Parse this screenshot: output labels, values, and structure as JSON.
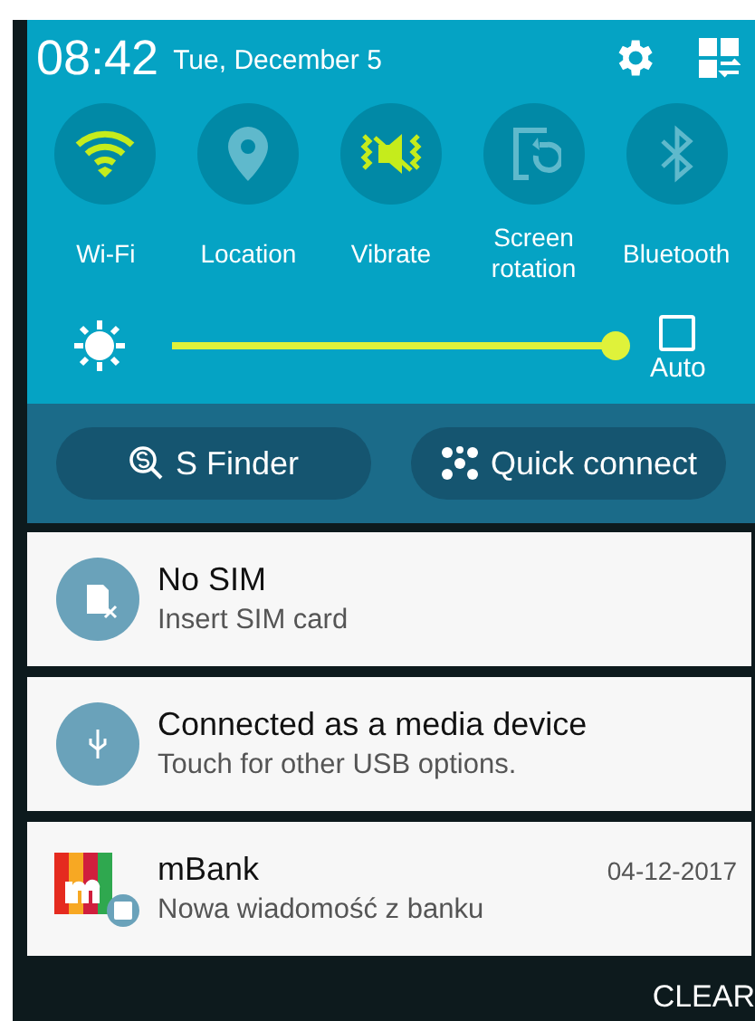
{
  "status": {
    "time": "08:42",
    "date": "Tue, December 5"
  },
  "toggles": [
    {
      "kind": "wifi",
      "label": "Wi-Fi",
      "on": true
    },
    {
      "kind": "location",
      "label": "Location",
      "on": false
    },
    {
      "kind": "vibrate",
      "label": "Vibrate",
      "on": true
    },
    {
      "kind": "rotation",
      "label": "Screen rotation",
      "on": false
    },
    {
      "kind": "bluetooth",
      "label": "Bluetooth",
      "on": false
    }
  ],
  "brightness": {
    "level": 0.98,
    "auto_label": "Auto",
    "auto_checked": false
  },
  "buttons": [
    {
      "kind": "finder",
      "label": "S Finder"
    },
    {
      "kind": "connect",
      "label": "Quick connect"
    }
  ],
  "notifications": [
    {
      "kind": "sim",
      "title": "No SIM",
      "text": "Insert SIM card"
    },
    {
      "kind": "usb",
      "title": "Connected as a media device",
      "text": "Touch for other USB options."
    },
    {
      "kind": "bank",
      "title": "mBank",
      "text": "Nowa wiadomość z banku",
      "time": "04-12-2017"
    }
  ],
  "clear": "CLEAR"
}
